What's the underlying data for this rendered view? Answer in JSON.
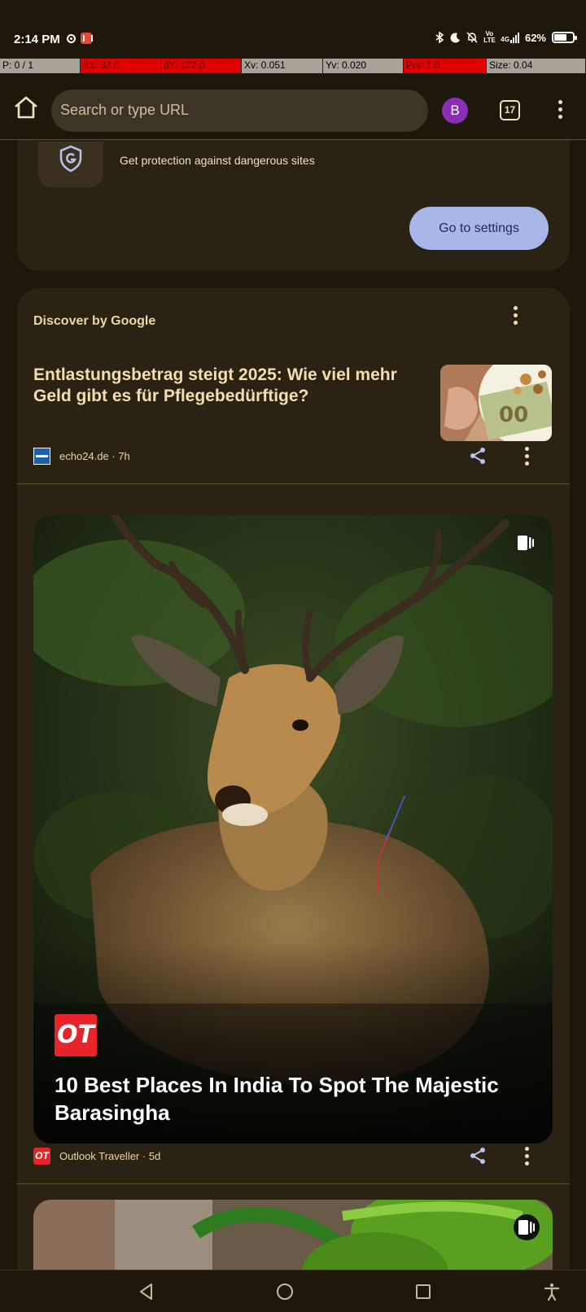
{
  "status_bar": {
    "time": "2:14 PM",
    "network": "4G",
    "battery": "62%",
    "lte_label": "Vo LTE"
  },
  "debug_bar": {
    "cells": [
      {
        "text": "P: 0 / 1",
        "style": "grey"
      },
      {
        "text": "dX: 33.0",
        "style": "red"
      },
      {
        "text": "dY: 122.0",
        "style": "red"
      },
      {
        "text": "Xv: 0.051",
        "style": "grey"
      },
      {
        "text": "Yv: 0.020",
        "style": "grey"
      },
      {
        "text": "Prs: 1.0",
        "style": "red"
      },
      {
        "text": "Size: 0.04",
        "style": "grey"
      }
    ]
  },
  "toolbar": {
    "search_placeholder": "Search or type URL",
    "avatar_letter": "B",
    "tab_count": "17"
  },
  "promo_card": {
    "description": "Get protection against dangerous sites",
    "button_label": "Go to settings"
  },
  "discover": {
    "header": "Discover by Google",
    "articles": [
      {
        "title": "Entlastungsbetrag steigt 2025: Wie viel mehr Geld gibt es für Pflegebedürftige?",
        "source": "echo24.de · 7h"
      },
      {
        "title": "10 Best Places In India To Spot The Majestic Barasingha",
        "source": "Outlook Traveller · 5d",
        "logo_text": "OT"
      }
    ]
  },
  "colors": {
    "background": "#1e170b",
    "card": "#2a2213",
    "accent_button": "#a8b6e8",
    "avatar": "#8a2fb5",
    "debug_red": "#e10000"
  }
}
